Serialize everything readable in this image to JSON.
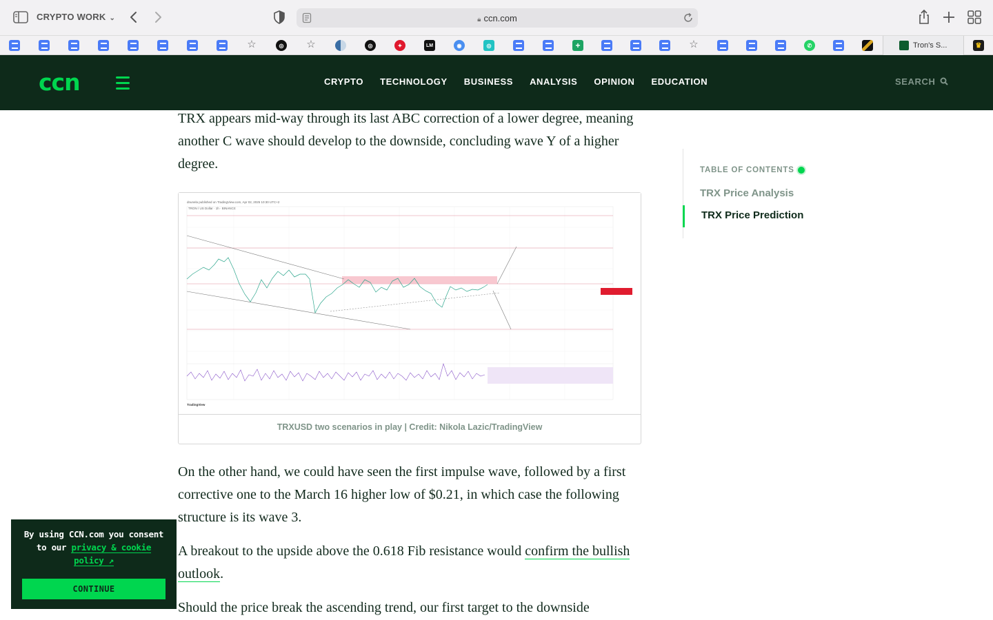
{
  "browser": {
    "tab_group": "CRYPTO WORK",
    "url": "ccn.com",
    "open_tab_title": "Tron's S..."
  },
  "bookmarks": {
    "icons": [
      "docs-icon",
      "docs-icon",
      "docs-icon",
      "docs-icon",
      "docs-icon",
      "docs-icon",
      "docs-icon",
      "docs-icon",
      "star-icon",
      "chatgpt-icon",
      "star-icon",
      "globe-icon",
      "chatgpt-icon",
      "fox-icon",
      "lm-icon",
      "target-icon",
      "camera-icon",
      "docs-icon",
      "docs-icon",
      "sheets-icon",
      "docs-icon",
      "docs-icon",
      "docs-icon",
      "star-icon",
      "docs-icon",
      "docs-icon",
      "docs-icon",
      "whatsapp-icon",
      "docs-icon",
      "photo-icon"
    ],
    "lm_label": "LM"
  },
  "site": {
    "logo": "ccn",
    "nav": [
      "CRYPTO",
      "TECHNOLOGY",
      "BUSINESS",
      "ANALYSIS",
      "OPINION",
      "EDUCATION"
    ],
    "search_label": "SEARCH",
    "brand_color": "#00d64f",
    "header_bg": "#0e2a1a"
  },
  "article": {
    "para1": "TRX appears mid-way through its last ABC correction of a lower degree, meaning another C wave should develop to the downside, concluding wave Y of a higher degree.",
    "figure_caption": "TRXUSD two scenarios in play | Credit: Nikola Lazic/TradingView",
    "chart_header": "dnunela published on TradingView.com, Apr 02, 2025 10:30 UTC+2",
    "chart_symbol": "TRON / US Dollar · 1h · BINANCE",
    "chart_brand": "TradingView",
    "para2": "On the other hand, we could have seen the first impulse wave, followed by a first corrective one to the March 16 higher low of $0.21, in which case the following structure is its wave 3.",
    "para3_before": "A breakout to the upside above the 0.618 Fib resistance would ",
    "para3_link": "confirm the bullish outlook",
    "para3_after": ".",
    "para4": "Should the price break the ascending trend, our first target to the downside"
  },
  "toc": {
    "title": "TABLE OF CONTENTS",
    "items": [
      "TRX Price Analysis",
      "TRX Price Prediction"
    ],
    "active": 1
  },
  "cookie": {
    "text_before": "By using CCN.com you consent to our ",
    "link": "privacy & cookie policy ↗",
    "button": "CONTINUE"
  }
}
